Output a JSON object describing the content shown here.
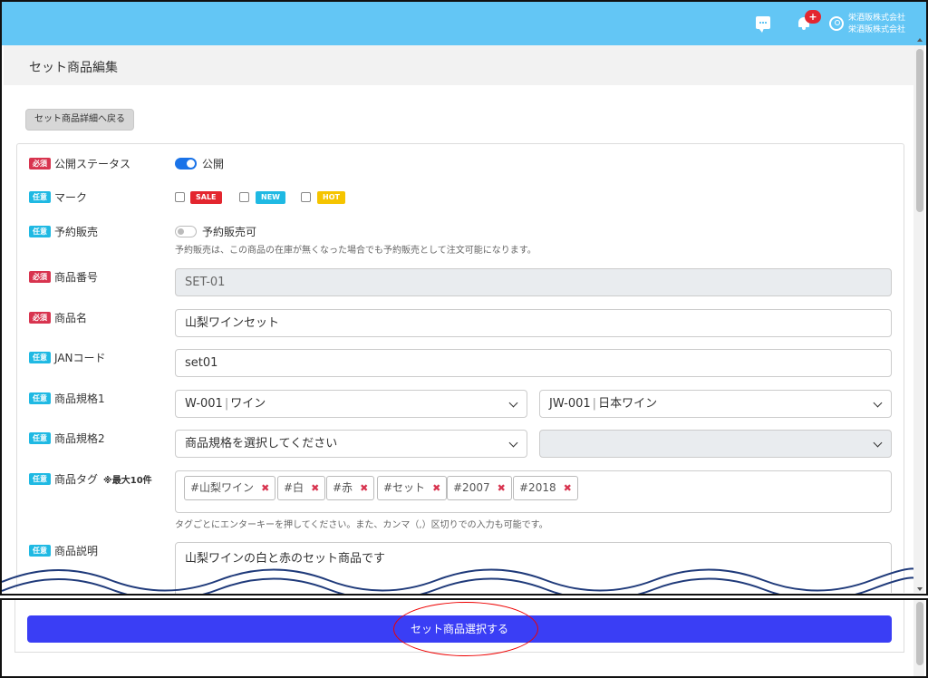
{
  "header": {
    "company_line1": "栄酒販株式会社",
    "company_line2": "栄酒販株式会社",
    "notification_count": "+"
  },
  "page": {
    "title": "セット商品編集",
    "back_button": "セット商品詳細へ戻る"
  },
  "badges": {
    "required": "必須",
    "optional": "任意"
  },
  "form": {
    "status": {
      "label": "公開ステータス",
      "toggle_label": "公開",
      "on": true
    },
    "mark": {
      "label": "マーク",
      "options": [
        "SALE",
        "NEW",
        "HOT"
      ],
      "colors": [
        "#e3262f",
        "#1fb9e3",
        "#f5c400"
      ]
    },
    "preorder": {
      "label": "予約販売",
      "toggle_label": "予約販売可",
      "on": false,
      "help": "予約販売は、この商品の在庫が無くなった場合でも予約販売として注文可能になります。"
    },
    "product_code": {
      "label": "商品番号",
      "value": "SET-01"
    },
    "product_name": {
      "label": "商品名",
      "value": "山梨ワインセット"
    },
    "jan": {
      "label": "JANコード",
      "value": "set01"
    },
    "spec1": {
      "label": "商品規格1",
      "value1_code": "W-001",
      "value1_name": "ワイン",
      "value2_code": "JW-001",
      "value2_name": "日本ワイン"
    },
    "spec2": {
      "label": "商品規格2",
      "placeholder": "商品規格を選択してください"
    },
    "tags": {
      "label": "商品タグ",
      "note": "※最大10件",
      "items": [
        "#山梨ワイン",
        "#白",
        "#赤",
        "#セット",
        "#2007",
        "#2018"
      ],
      "help": "タグごとにエンターキーを押してください。また、カンマ（,）区切りでの入力も可能です。"
    },
    "description": {
      "label": "商品説明",
      "value": "山梨ワインの白と赤のセット商品です"
    }
  },
  "footer": {
    "submit": "セット商品選択する"
  }
}
